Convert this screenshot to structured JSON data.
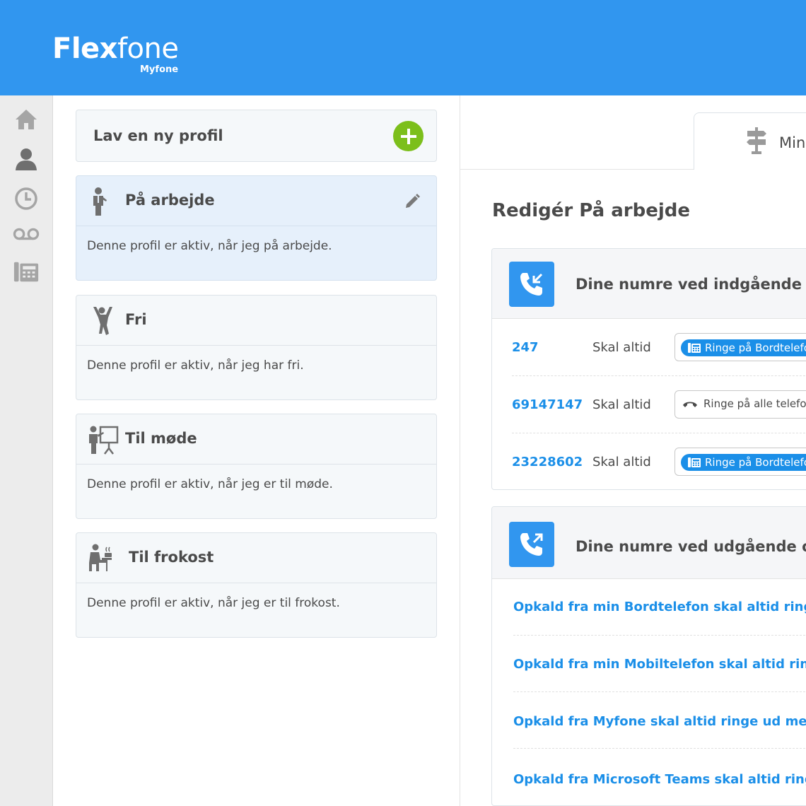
{
  "brand": {
    "name_bold": "Flex",
    "name_light": "fone",
    "sub": "Myfone",
    "color": "#3196ef"
  },
  "rail": {
    "items": [
      "home-icon",
      "user-icon",
      "clock-icon",
      "voicemail-icon",
      "deskphone-icon"
    ]
  },
  "profiles": {
    "new_label": "Lav en ny profil",
    "items": [
      {
        "title": "På arbejde",
        "desc": "Denne profil er aktiv, når jeg på arbejde.",
        "icon": "businessman-icon",
        "active": true
      },
      {
        "title": "Fri",
        "desc": "Denne profil er aktiv, når jeg har fri.",
        "icon": "jumping-person-icon",
        "active": false
      },
      {
        "title": "Til møde",
        "desc": "Denne profil er aktiv, når jeg er til møde.",
        "icon": "presentation-icon",
        "active": false
      },
      {
        "title": "Til frokost",
        "desc": "Denne profil er aktiv, når jeg er til frokost.",
        "icon": "lunch-icon",
        "active": false
      }
    ]
  },
  "right": {
    "tab_label": "Min",
    "edit_title": "Redigér På arbejde",
    "incoming": {
      "title": "Dine numre ved indgående op",
      "rows": [
        {
          "number": "247",
          "rule": "Skal altid",
          "option": "Ringe på Bordtelefo",
          "highlight": true
        },
        {
          "number": "69147147",
          "rule": "Skal altid",
          "option": "Ringe på alle telefon",
          "highlight": false
        },
        {
          "number": "23228602",
          "rule": "Skal altid",
          "option": "Ringe på Bordtelefo",
          "highlight": true
        }
      ]
    },
    "outgoing": {
      "title": "Dine numre ved udgående opk",
      "rows": [
        "Opkald fra min Bordtelefon skal altid ringe ud m",
        "Opkald fra min Mobiltelefon skal altid ringe ud r",
        "Opkald fra Myfone skal altid ringe ud med",
        "Opkald fra Microsoft Teams skal altid ringe ud m"
      ]
    }
  },
  "colors": {
    "accent": "#3196ef",
    "link": "#1b8fe8",
    "add": "#7cbf1b",
    "active_card": "#e6f0fb"
  }
}
